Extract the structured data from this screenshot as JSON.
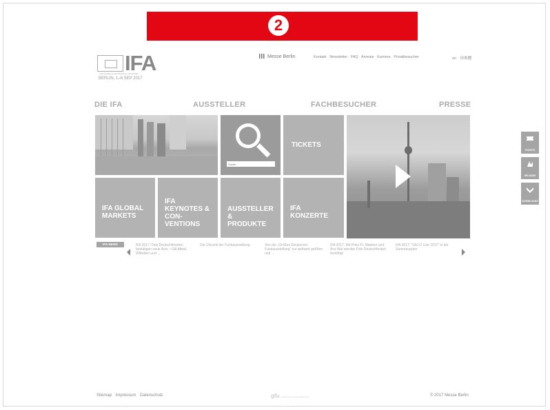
{
  "badge": {
    "number": "2"
  },
  "logo": {
    "name": "IFA",
    "subtitle": "CONSUMER ELECTRONICS UNLIMITED",
    "date": "BERLIN, 1–6 SEP 2017"
  },
  "messe": {
    "label": "Messe Berlin"
  },
  "topnav": [
    "Kontakt",
    "Newsletter",
    "FAQ",
    "Anreise",
    "Karriere",
    "Privatbesucher"
  ],
  "lang": [
    "en",
    "日本語"
  ],
  "mainnav": [
    "DIE IFA",
    "AUSSTELLER",
    "FACHBESUCHER",
    "PRESSE"
  ],
  "search": {
    "placeholder": "Suche"
  },
  "tiles": {
    "tickets": "TICKETS",
    "global_markets": "IFA GLOBAL\nMARKETS",
    "keynotes": "IFA\nKEYNOTES &\nCON-\nVENTIONS",
    "aussteller": "AUSSTELLER\n&\nPRODUKTE",
    "konzerte": "IFA\nKONZERTE"
  },
  "news": {
    "label": "IFA-NEWS",
    "items": [
      "IFA 2017: Fritz Deutschlfreeten bestätigen neue Acts – Gill Abbel, Willsiden und ...",
      "Die Chronik der Funkausstellung",
      "Von der „Großen Deutschen Funkausstellung“ zur weltweit größten und ...",
      "IFA 2017: Mit Prinz Pi, Madsen und Ace Wei werden Fritz Deutschfesten bestätigt",
      "IFA 2017: \"GELO Live 2017\" in die Sommerguten"
    ]
  },
  "side_buttons": [
    "TICKETS",
    "GELÄNDE",
    "DOWNLOADS"
  ],
  "footer": {
    "links": [
      "Sitemap",
      "Impressum",
      "Datenschutz"
    ],
    "partner": "gfu",
    "partner_sub": "Consumer & Home Electronics",
    "copyright": "© 2017 Messe Berlin"
  }
}
